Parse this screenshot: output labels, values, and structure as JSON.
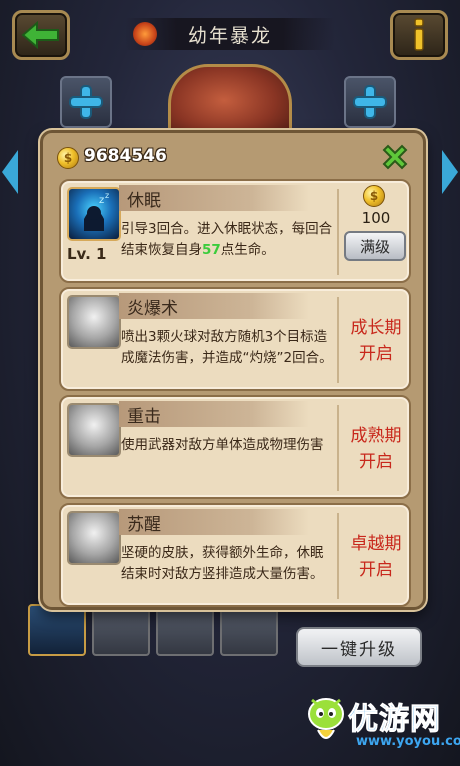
{
  "header": {
    "title": "幼年暴龙",
    "back_icon": "back-arrow-icon",
    "info_icon": "info-icon"
  },
  "currency": {
    "gold": "9684546",
    "gold_icon": "coin-icon"
  },
  "skills": [
    {
      "name": "休眠",
      "desc_before": "引导3回合。进入休眠状态，每回合结束恢复自身",
      "desc_highlight": "57",
      "desc_after": "点生命。",
      "level": "Lv. 1",
      "cost": "100",
      "button": "满级",
      "icon": "sleep-skill-icon"
    },
    {
      "name": "炎爆术",
      "desc": "喷出3颗火球对敌方随机3个目标造成魔法伤害，并造成“灼烧”2回合。",
      "unlock": [
        "成长期",
        "开启"
      ],
      "icon": "fireball-skill-icon"
    },
    {
      "name": "重击",
      "desc": "使用武器对敌方单体造成物理伤害",
      "unlock": [
        "成熟期",
        "开启"
      ],
      "icon": "heavy-strike-skill-icon"
    },
    {
      "name": "苏醒",
      "desc": "坚硬的皮肤，获得额外生命，休眠结束时对敌方竖排造成大量伤害。",
      "unlock": [
        "卓越期",
        "开启"
      ],
      "icon": "awaken-skill-icon"
    }
  ],
  "footer": {
    "upgrade_all": "一键升级"
  },
  "watermark": {
    "name": "优游网",
    "url": "www.yoyou.com"
  },
  "colors": {
    "locked_text": "#c8281c",
    "highlight": "#3ccc3c",
    "panel": "#ecdcbf",
    "accent_blue": "#3aa8d8"
  }
}
